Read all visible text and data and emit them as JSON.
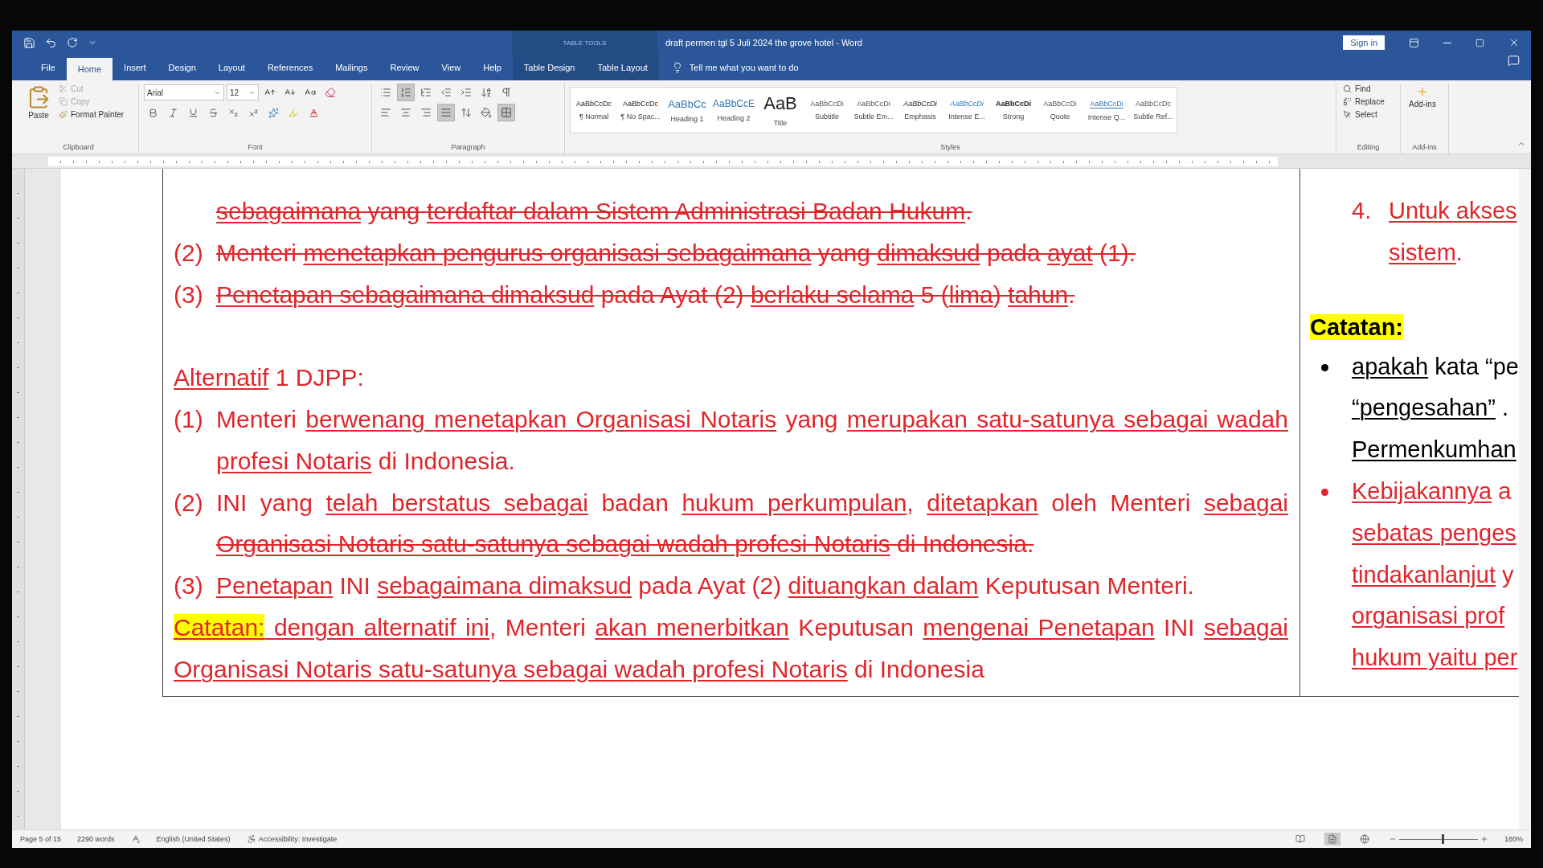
{
  "window": {
    "title": "draft permen tgl 5 Juli 2024 the grove hotel  -  Word",
    "context_label": "TABLE TOOLS",
    "sign_in": "Sign in"
  },
  "tabs": [
    {
      "label": "File",
      "selected": false,
      "contextual": false
    },
    {
      "label": "Home",
      "selected": true,
      "contextual": false
    },
    {
      "label": "Insert",
      "selected": false,
      "contextual": false
    },
    {
      "label": "Design",
      "selected": false,
      "contextual": false
    },
    {
      "label": "Layout",
      "selected": false,
      "contextual": false
    },
    {
      "label": "References",
      "selected": false,
      "contextual": false
    },
    {
      "label": "Mailings",
      "selected": false,
      "contextual": false
    },
    {
      "label": "Review",
      "selected": false,
      "contextual": false
    },
    {
      "label": "View",
      "selected": false,
      "contextual": false
    },
    {
      "label": "Help",
      "selected": false,
      "contextual": false
    },
    {
      "label": "Table Design",
      "selected": false,
      "contextual": true
    },
    {
      "label": "Table Layout",
      "selected": false,
      "contextual": true
    }
  ],
  "tell_me": "Tell me what you want to do",
  "ribbon": {
    "clipboard": {
      "label": "Clipboard",
      "paste": "Paste",
      "items": [
        {
          "label": "Cut",
          "disabled": true
        },
        {
          "label": "Copy",
          "disabled": true
        },
        {
          "label": "Format Painter",
          "disabled": false
        }
      ]
    },
    "font": {
      "label": "Font",
      "name": "Arial",
      "size": "12"
    },
    "paragraph": {
      "label": "Paragraph",
      "buttons": [
        {
          "pressed": false
        },
        {
          "pressed": true
        },
        {
          "pressed": false
        },
        {
          "pressed": false
        },
        {
          "pressed": false
        },
        {
          "pressed": false
        },
        {
          "pressed": false
        },
        {
          "pressed": false
        },
        {
          "pressed": false
        },
        {
          "pressed": false
        },
        {
          "pressed": true
        },
        {
          "pressed": false
        },
        {
          "pressed": false
        },
        {
          "pressed": true
        }
      ]
    },
    "styles": {
      "label": "Styles",
      "items": [
        {
          "preview": "AaBbCcDc",
          "name": "¶ Normal",
          "kind": "normal"
        },
        {
          "preview": "AaBbCcDc",
          "name": "¶ No Spac...",
          "kind": "normal"
        },
        {
          "preview": "AaBbCc",
          "name": "Heading 1",
          "kind": "heading1"
        },
        {
          "preview": "AaBbCcE",
          "name": "Heading 2",
          "kind": "heading2"
        },
        {
          "preview": "AaB",
          "name": "Title",
          "kind": "title"
        },
        {
          "preview": "AaBbCcDi",
          "name": "Subtitle",
          "kind": "subtle"
        },
        {
          "preview": "AaBbCcDi",
          "name": "Subtle Em...",
          "kind": "subtle"
        },
        {
          "preview": "AaBbCcDi",
          "name": "Emphasis",
          "kind": "emphasis"
        },
        {
          "preview": "AaBbCcDi",
          "name": "Intense E...",
          "kind": "intense"
        },
        {
          "preview": "AaBbCcDi",
          "name": "Strong",
          "kind": "strong"
        },
        {
          "preview": "AaBbCcDi",
          "name": "Quote",
          "kind": "subtle"
        },
        {
          "preview": "AaBbCcDi",
          "name": "Intense Q...",
          "kind": "intense_quote"
        },
        {
          "preview": "AaBbCcDc",
          "name": "Subtle Ref...",
          "kind": "subtle"
        }
      ]
    },
    "editing": {
      "label": "Editing",
      "find": "Find",
      "replace": "Replace",
      "select": "Select"
    },
    "addins": {
      "label": "Add-ins",
      "button": "Add-ins"
    }
  },
  "document": {
    "left_cell": {
      "current": [
        {
          "runs": [
            {
              "text": "sebagaimana",
              "underline": true,
              "strike": true
            },
            {
              "text": " yang ",
              "underline": false,
              "strike": true
            },
            {
              "text": "terdaftar dalam Sistem Administrasi Badan Hukum",
              "underline": true,
              "strike": true
            },
            {
              "text": ".",
              "underline": false,
              "strike": true
            }
          ]
        },
        {
          "number": "(2)",
          "runs": [
            {
              "text": "Menteri ",
              "underline": false,
              "strike": true
            },
            {
              "text": "menetapkan pengurus organisasi sebagaimana",
              "underline": true,
              "strike": true
            },
            {
              "text": " yang ",
              "underline": false,
              "strike": true
            },
            {
              "text": "dimaksud",
              "underline": true,
              "strike": true
            },
            {
              "text": " pada ",
              "underline": false,
              "strike": true
            },
            {
              "text": "ayat",
              "underline": true,
              "strike": true
            },
            {
              "text": " (1).",
              "underline": false,
              "strike": true
            }
          ]
        },
        {
          "number": "(3)",
          "runs": [
            {
              "text": "Penetapan sebagaimana dimaksud",
              "underline": true,
              "strike": true
            },
            {
              "text": " pada Ayat (2) ",
              "underline": false,
              "strike": true
            },
            {
              "text": "berlaku selama",
              "underline": true,
              "strike": true
            },
            {
              "text": " 5 (",
              "underline": false,
              "strike": true
            },
            {
              "text": "lima",
              "underline": true,
              "strike": true
            },
            {
              "text": ") ",
              "underline": false,
              "strike": true
            },
            {
              "text": "tahun",
              "underline": true,
              "strike": true
            },
            {
              "text": ".",
              "underline": false,
              "strike": true
            }
          ]
        }
      ],
      "alternative": {
        "heading": [
          {
            "text": "Alternatif",
            "underline": true
          },
          {
            "text": " 1 DJPP:",
            "underline": false
          }
        ],
        "items": [
          {
            "number": "(1)",
            "runs": [
              {
                "text": "Menteri ",
                "underline": false
              },
              {
                "text": "berwenang menetapkan Organisasi Notaris",
                "underline": true
              },
              {
                "text": " yang ",
                "underline": false
              },
              {
                "text": "merupakan satu-satunya sebagai wadah profesi Notaris",
                "underline": true
              },
              {
                "text": " di Indonesia.",
                "underline": false
              }
            ]
          },
          {
            "number": "(2)",
            "runs": [
              {
                "text": "INI yang ",
                "underline": false
              },
              {
                "text": "telah berstatus sebagai",
                "underline": true
              },
              {
                "text": " badan ",
                "underline": false
              },
              {
                "text": "hukum perkumpulan",
                "underline": true
              },
              {
                "text": ", ",
                "underline": false
              },
              {
                "text": "ditetapkan",
                "underline": true
              },
              {
                "text": " oleh Menteri ",
                "underline": false
              },
              {
                "text": "sebagai ",
                "underline": true
              },
              {
                "text": "Organisasi Notaris satu-satunya sebagai wadah profesi Notaris",
                "underline": true,
                "strike": true
              },
              {
                "text": " di Indonesia.",
                "underline": false,
                "strike": true
              }
            ]
          },
          {
            "number": "(3)",
            "runs": [
              {
                "text": "Penetapan",
                "underline": true
              },
              {
                "text": " INI ",
                "underline": false
              },
              {
                "text": "sebagaimana dimaksud",
                "underline": true
              },
              {
                "text": " pada Ayat (2) ",
                "underline": false
              },
              {
                "text": "dituangkan dalam",
                "underline": true
              },
              {
                "text": " Keputusan Menteri.",
                "underline": false
              }
            ]
          }
        ],
        "note": [
          {
            "text": "Catatan:",
            "underline": true,
            "highlight": true
          },
          {
            "text": " dengan alternatif ini",
            "underline": true
          },
          {
            "text": ", Menteri ",
            "underline": false
          },
          {
            "text": "akan menerbitkan",
            "underline": true
          },
          {
            "text": " Keputusan ",
            "underline": false
          },
          {
            "text": "mengenai Penetapan",
            "underline": true
          },
          {
            "text": " INI ",
            "underline": false
          },
          {
            "text": "sebagai Organisasi Notaris satu-satunya sebagai wadah profesi Notaris",
            "underline": true
          },
          {
            "text": " di Indonesia",
            "underline": false
          }
        ]
      }
    },
    "right_cell": {
      "items": [
        {
          "kind": "numbered",
          "number": "4.",
          "color": "#e0262b",
          "lines": [
            [
              {
                "text": "Untuk akses",
                "underline": true
              }
            ],
            [
              {
                "text": "sistem",
                "underline": true
              },
              {
                "text": ".",
                "underline": false
              }
            ]
          ]
        },
        {
          "kind": "heading",
          "text": "Catatan:"
        },
        {
          "kind": "bullet",
          "color": "#000000",
          "lines": [
            [
              {
                "text": "apakah",
                "underline": true
              },
              {
                "text": " kata “pe",
                "underline": false
              }
            ],
            [
              {
                "text": "“pengesahan”",
                "underline": true
              },
              {
                "text": "  .",
                "underline": false
              }
            ],
            [
              {
                "text": "Permenkumhan",
                "underline": true
              }
            ]
          ]
        },
        {
          "kind": "bullet",
          "color": "#e0262b",
          "lines": [
            [
              {
                "text": "Kebijakannya",
                "underline": true
              },
              {
                "text": "  a",
                "underline": false
              }
            ],
            [
              {
                "text": "sebatas  penges",
                "underline": true
              }
            ],
            [
              {
                "text": "tindakanlanjut",
                "underline": true
              },
              {
                "text": " y",
                "underline": false
              }
            ],
            [
              {
                "text": "organisasi  prof",
                "underline": true
              }
            ],
            [
              {
                "text": "hukum yaitu per",
                "underline": true
              }
            ]
          ]
        }
      ]
    }
  },
  "status_bar": {
    "page": "Page 5 of 15",
    "words": "2290 words",
    "language": "English (United States)",
    "accessibility": "Accessibility: Investigate",
    "views": [
      {
        "selected": false
      },
      {
        "selected": true
      },
      {
        "selected": false
      }
    ],
    "zoom": {
      "level": 0.57,
      "reading": "180%"
    }
  }
}
